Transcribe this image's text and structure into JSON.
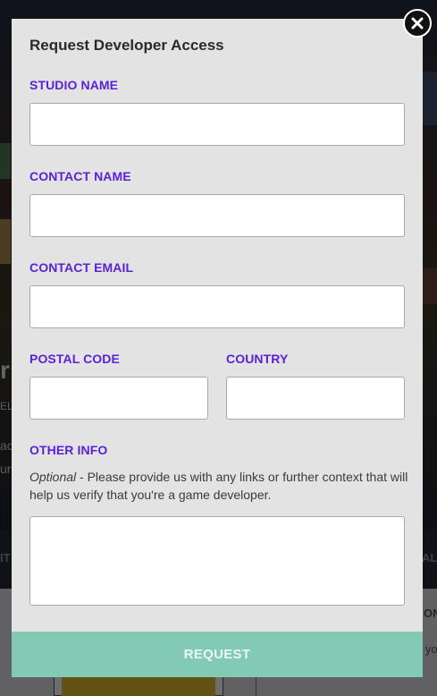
{
  "background": {
    "strip_left": "IT",
    "strip_right": "AL",
    "side_text_1": "ON",
    "side_text_2": "yo",
    "hero_text_1": "r",
    "hero_text_2": "EL",
    "hero_text_3": "ac",
    "hero_text_4": "ure"
  },
  "modal": {
    "title": "Request Developer Access",
    "fields": {
      "studio_name": {
        "label": "STUDIO NAME",
        "value": ""
      },
      "contact_name": {
        "label": "CONTACT NAME",
        "value": ""
      },
      "contact_email": {
        "label": "CONTACT EMAIL",
        "value": ""
      },
      "postal_code": {
        "label": "POSTAL CODE",
        "value": ""
      },
      "country": {
        "label": "COUNTRY",
        "value": ""
      },
      "other_info": {
        "label": "OTHER INFO",
        "hint_optional": "Optional",
        "hint_text": " - Please provide us with any links or further context that will help us verify that you're a game developer.",
        "value": ""
      }
    },
    "submit_label": "REQUEST",
    "close_icon": "close-icon"
  },
  "colors": {
    "label_accent": "#5a22d6",
    "submit_button": "#82cab4",
    "modal_bg": "#e3e3e3"
  }
}
